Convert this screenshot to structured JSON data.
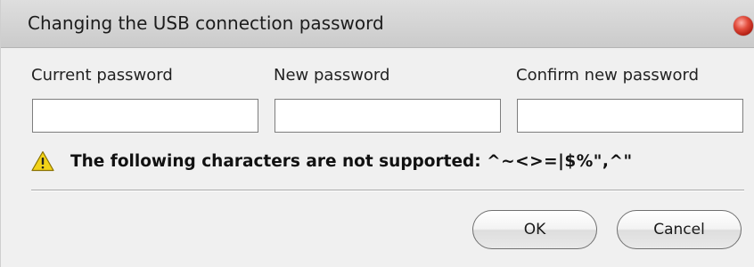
{
  "dialog": {
    "title": "Changing the USB connection password"
  },
  "fields": {
    "current": {
      "label": "Current password",
      "value": ""
    },
    "new": {
      "label": "New password",
      "value": ""
    },
    "confirm": {
      "label": "Confirm new password",
      "value": ""
    }
  },
  "warning": {
    "icon": "warning-icon",
    "text": "The following characters are not supported: ",
    "chars": "^~<>=|$%\",^\""
  },
  "buttons": {
    "ok_label": "OK",
    "cancel_label": "Cancel"
  },
  "colors": {
    "warning_fill": "#f2d218",
    "close_button": "#d8382a"
  }
}
